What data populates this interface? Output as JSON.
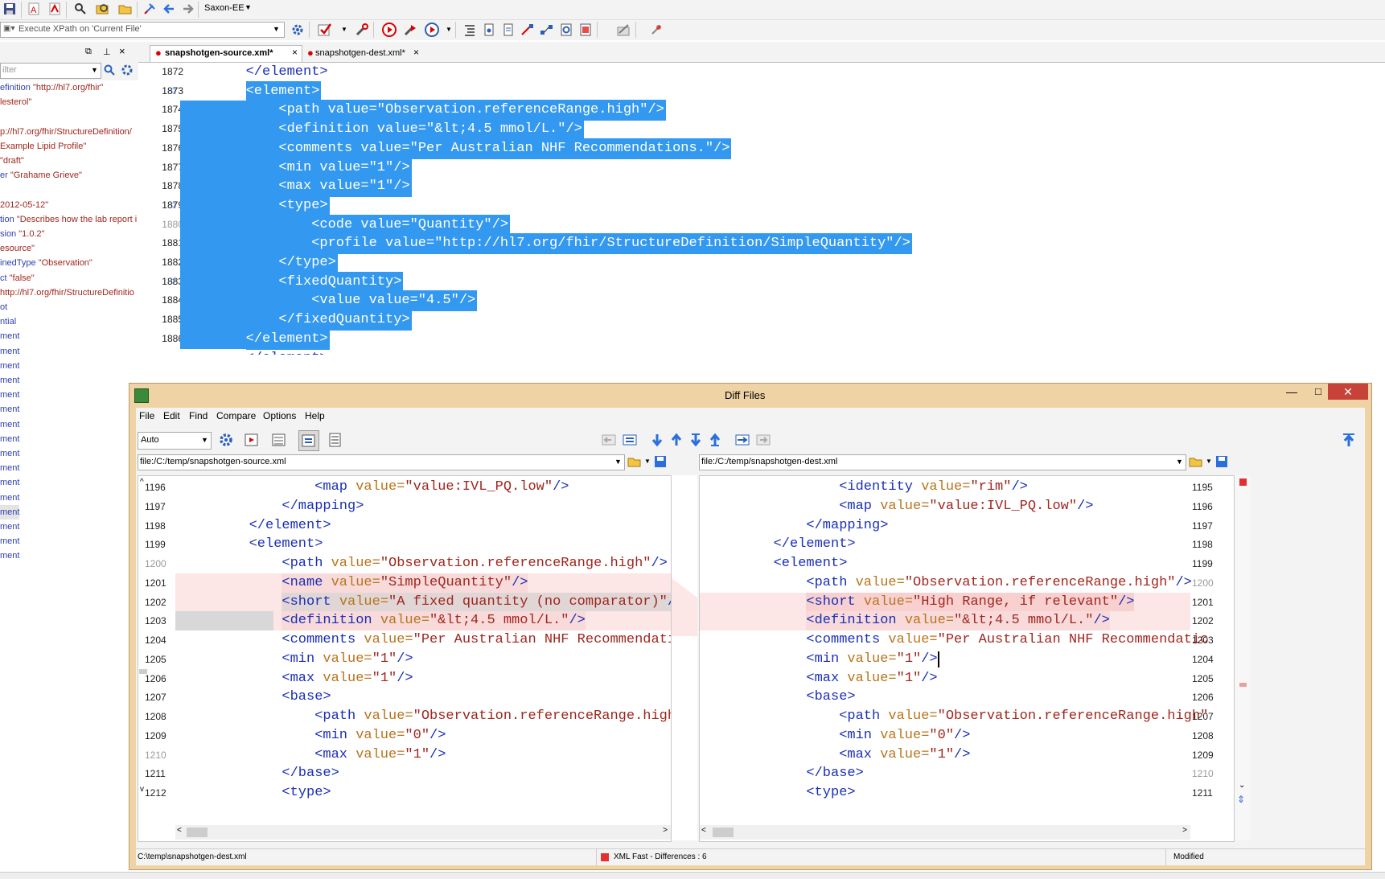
{
  "toolbar": {
    "transformer": "Saxon-EE",
    "xpath_label": "Execute XPath on 'Current File'"
  },
  "tabs": [
    {
      "label": "snapshotgen-source.xml*"
    },
    {
      "label": "snapshotgen-dest.xml*"
    }
  ],
  "outline": {
    "filter_placeholder": "ilter",
    "items": [
      {
        "name": "efinition",
        "value": "\"http://hl7.org/fhir\""
      },
      {
        "name": "",
        "value": "lesterol\""
      },
      {
        "name": "",
        "value": ""
      },
      {
        "name": "",
        "value": "p://hl7.org/fhir/StructureDefinition/"
      },
      {
        "name": "",
        "value": "Example Lipid Profile\""
      },
      {
        "name": "",
        "value": "\"draft\""
      },
      {
        "name": "er",
        "value": "\"Grahame Grieve\""
      },
      {
        "name": "",
        "value": ""
      },
      {
        "name": "",
        "value": "2012-05-12\""
      },
      {
        "name": "tion",
        "value": "\"Describes how the lab report i"
      },
      {
        "name": "sion",
        "value": "\"1.0.2\""
      },
      {
        "name": "",
        "value": "esource\""
      },
      {
        "name": "inedType",
        "value": "\"Observation\""
      },
      {
        "name": "ct",
        "value": "\"false\""
      },
      {
        "name": "",
        "value": "http://hl7.org/fhir/StructureDefinitio"
      },
      {
        "name": "ot",
        "value": ""
      },
      {
        "name": "ntial",
        "value": ""
      },
      {
        "name": "ment",
        "value": ""
      },
      {
        "name": "ment",
        "value": ""
      },
      {
        "name": "ment",
        "value": ""
      },
      {
        "name": "ment",
        "value": ""
      },
      {
        "name": "ment",
        "value": ""
      },
      {
        "name": "ment",
        "value": ""
      },
      {
        "name": "ment",
        "value": ""
      },
      {
        "name": "ment",
        "value": ""
      },
      {
        "name": "ment",
        "value": ""
      },
      {
        "name": "ment",
        "value": ""
      },
      {
        "name": "ment",
        "value": ""
      },
      {
        "name": "ment",
        "value": ""
      },
      {
        "name": "ment",
        "value": ""
      },
      {
        "name": "ment",
        "value": ""
      },
      {
        "name": "ment",
        "value": ""
      },
      {
        "name": "ment",
        "value": ""
      }
    ]
  },
  "editor": {
    "lines": [
      {
        "n": "1872",
        "indent": 8,
        "parts": [
          [
            "tag",
            "</element>"
          ]
        ],
        "selected": false,
        "fold": false
      },
      {
        "n": "1873",
        "indent": 8,
        "parts": [
          [
            "tag",
            "<element>"
          ]
        ],
        "selected": true,
        "fold": true
      },
      {
        "n": "1874",
        "indent": 12,
        "parts": [
          [
            "tag",
            "<path value=\"Observation.referenceRange.high\"/>"
          ]
        ],
        "selected": true,
        "fold": false
      },
      {
        "n": "1875",
        "indent": 12,
        "parts": [
          [
            "tag",
            "<definition value=\"&lt;4.5 mmol/L.\"/>"
          ]
        ],
        "selected": true,
        "fold": false
      },
      {
        "n": "1876",
        "indent": 12,
        "parts": [
          [
            "tag",
            "<comments value=\"Per Australian NHF Recommendations.\"/>"
          ]
        ],
        "selected": true,
        "fold": false
      },
      {
        "n": "1877",
        "indent": 12,
        "parts": [
          [
            "tag",
            "<min value=\"1\"/>"
          ]
        ],
        "selected": true,
        "fold": false
      },
      {
        "n": "1878",
        "indent": 12,
        "parts": [
          [
            "tag",
            "<max value=\"1\"/>"
          ]
        ],
        "selected": true,
        "fold": false
      },
      {
        "n": "1879",
        "indent": 12,
        "parts": [
          [
            "tag",
            "<type>"
          ]
        ],
        "selected": true,
        "fold": true
      },
      {
        "n": "1880",
        "indent": 16,
        "parts": [
          [
            "tag",
            "<code value=\"Quantity\"/>"
          ]
        ],
        "selected": true,
        "fold": false
      },
      {
        "n": "1881",
        "indent": 16,
        "parts": [
          [
            "tag",
            "<profile value=\"http://hl7.org/fhir/StructureDefinition/SimpleQuantity\"/>"
          ]
        ],
        "selected": true,
        "fold": false
      },
      {
        "n": "1882",
        "indent": 12,
        "parts": [
          [
            "tag",
            "</type>"
          ]
        ],
        "selected": true,
        "fold": false
      },
      {
        "n": "1883",
        "indent": 12,
        "parts": [
          [
            "tag",
            "<fixedQuantity>"
          ]
        ],
        "selected": true,
        "fold": true
      },
      {
        "n": "1884",
        "indent": 16,
        "parts": [
          [
            "tag",
            "<value value=\"4.5\"/>"
          ]
        ],
        "selected": true,
        "fold": false
      },
      {
        "n": "1885",
        "indent": 12,
        "parts": [
          [
            "tag",
            "</fixedQuantity>"
          ]
        ],
        "selected": true,
        "fold": false
      },
      {
        "n": "1886",
        "indent": 8,
        "parts": [
          [
            "tag",
            "</element>"
          ]
        ],
        "selected": true,
        "fold": false
      }
    ]
  },
  "diff": {
    "title": "Diff Files",
    "menu": [
      "File",
      "Edit",
      "Find",
      "Compare",
      "Options",
      "Help"
    ],
    "mode": "Auto",
    "left_path": "file:/C:/temp/snapshotgen-source.xml",
    "right_path": "file:/C:/temp/snapshotgen-dest.xml",
    "status_path": "C:\\temp\\snapshotgen-dest.xml",
    "status_diff": "XML Fast - Differences : 6",
    "status_modified": "Modified",
    "left_lines": [
      {
        "n": "1196",
        "indent": 16,
        "parts": [
          [
            "tag",
            "<map "
          ],
          [
            "attr",
            "value="
          ],
          [
            "val",
            "\"value:IVL_PQ.low\""
          ],
          [
            "tag",
            "/>"
          ]
        ],
        "hl": ""
      },
      {
        "n": "1197",
        "indent": 12,
        "parts": [
          [
            "tag",
            "</mapping>"
          ]
        ],
        "hl": ""
      },
      {
        "n": "1198",
        "indent": 8,
        "parts": [
          [
            "tag",
            "</element>"
          ]
        ],
        "hl": ""
      },
      {
        "n": "1199",
        "indent": 8,
        "parts": [
          [
            "tag",
            "<element>"
          ]
        ],
        "hl": ""
      },
      {
        "n": "1200",
        "indent": 12,
        "parts": [
          [
            "tag",
            "<path "
          ],
          [
            "attr",
            "value="
          ],
          [
            "val",
            "\"Observation.referenceRange.high\""
          ],
          [
            "tag",
            "/>"
          ]
        ],
        "hl": ""
      },
      {
        "n": "1201",
        "indent": 12,
        "parts": [
          [
            "tag",
            "<name "
          ],
          [
            "attr",
            "value="
          ],
          [
            "val",
            "\"SimpleQuantity\""
          ],
          [
            "tag",
            "/>"
          ]
        ],
        "hl": "pink"
      },
      {
        "n": "1202",
        "indent": 12,
        "parts": [
          [
            "tag",
            "<short "
          ],
          [
            "attr",
            "value="
          ],
          [
            "val",
            "\"A fixed quantity (no comparator)\""
          ],
          [
            "tag",
            "/>"
          ]
        ],
        "hl": "pinkstrong"
      },
      {
        "n": "1203",
        "indent": 12,
        "parts": [
          [
            "tag",
            "<definition "
          ],
          [
            "attr",
            "value="
          ],
          [
            "val",
            "\"&lt;4.5 mmol/L.\""
          ],
          [
            "tag",
            "/>"
          ]
        ],
        "hl": "pinkgray"
      },
      {
        "n": "1204",
        "indent": 12,
        "parts": [
          [
            "tag",
            "<comments "
          ],
          [
            "attr",
            "value="
          ],
          [
            "val",
            "\"Per Australian NHF Recommendatio"
          ]
        ],
        "hl": ""
      },
      {
        "n": "1205",
        "indent": 12,
        "parts": [
          [
            "tag",
            "<min "
          ],
          [
            "attr",
            "value="
          ],
          [
            "val",
            "\"1\""
          ],
          [
            "tag",
            "/>"
          ]
        ],
        "hl": ""
      },
      {
        "n": "1206",
        "indent": 12,
        "parts": [
          [
            "tag",
            "<max "
          ],
          [
            "attr",
            "value="
          ],
          [
            "val",
            "\"1\""
          ],
          [
            "tag",
            "/>"
          ]
        ],
        "hl": ""
      },
      {
        "n": "1207",
        "indent": 12,
        "parts": [
          [
            "tag",
            "<base>"
          ]
        ],
        "hl": ""
      },
      {
        "n": "1208",
        "indent": 16,
        "parts": [
          [
            "tag",
            "<path "
          ],
          [
            "attr",
            "value="
          ],
          [
            "val",
            "\"Observation.referenceRange.high\""
          ]
        ],
        "hl": ""
      },
      {
        "n": "1209",
        "indent": 16,
        "parts": [
          [
            "tag",
            "<min "
          ],
          [
            "attr",
            "value="
          ],
          [
            "val",
            "\"0\""
          ],
          [
            "tag",
            "/>"
          ]
        ],
        "hl": ""
      },
      {
        "n": "1210",
        "indent": 16,
        "parts": [
          [
            "tag",
            "<max "
          ],
          [
            "attr",
            "value="
          ],
          [
            "val",
            "\"1\""
          ],
          [
            "tag",
            "/>"
          ]
        ],
        "hl": ""
      },
      {
        "n": "1211",
        "indent": 12,
        "parts": [
          [
            "tag",
            "</base>"
          ]
        ],
        "hl": ""
      },
      {
        "n": "1212",
        "indent": 12,
        "parts": [
          [
            "tag",
            "<type>"
          ]
        ],
        "hl": ""
      }
    ],
    "right_lines": [
      {
        "n": "1195",
        "indent": 16,
        "parts": [
          [
            "tag",
            "<identity "
          ],
          [
            "attr",
            "value="
          ],
          [
            "val",
            "\"rim\""
          ],
          [
            "tag",
            "/>"
          ]
        ],
        "hl": ""
      },
      {
        "n": "1196",
        "indent": 16,
        "parts": [
          [
            "tag",
            "<map "
          ],
          [
            "attr",
            "value="
          ],
          [
            "val",
            "\"value:IVL_PQ.low\""
          ],
          [
            "tag",
            "/>"
          ]
        ],
        "hl": ""
      },
      {
        "n": "1197",
        "indent": 12,
        "parts": [
          [
            "tag",
            "</mapping>"
          ]
        ],
        "hl": ""
      },
      {
        "n": "1198",
        "indent": 8,
        "parts": [
          [
            "tag",
            "</element>"
          ]
        ],
        "hl": ""
      },
      {
        "n": "1199",
        "indent": 8,
        "parts": [
          [
            "tag",
            "<element>"
          ]
        ],
        "hl": ""
      },
      {
        "n": "1200",
        "indent": 12,
        "parts": [
          [
            "tag",
            "<path "
          ],
          [
            "attr",
            "value="
          ],
          [
            "val",
            "\"Observation.referenceRange.high\""
          ],
          [
            "tag",
            "/>"
          ]
        ],
        "hl": ""
      },
      {
        "n": "1201",
        "indent": 12,
        "parts": [
          [
            "tag",
            "<short "
          ],
          [
            "attr",
            "value="
          ],
          [
            "val",
            "\"High Range, if relevant\""
          ],
          [
            "tag",
            "/>"
          ]
        ],
        "hl": "pinkstrong"
      },
      {
        "n": "1202",
        "indent": 12,
        "parts": [
          [
            "tag",
            "<definition "
          ],
          [
            "attr",
            "value="
          ],
          [
            "val",
            "\"&lt;4.5 mmol/L.\""
          ],
          [
            "tag",
            "/>"
          ]
        ],
        "hl": "pink"
      },
      {
        "n": "1203",
        "indent": 12,
        "parts": [
          [
            "tag",
            "<comments "
          ],
          [
            "attr",
            "value="
          ],
          [
            "val",
            "\"Per Australian NHF Recommendatic"
          ]
        ],
        "hl": ""
      },
      {
        "n": "1204",
        "indent": 12,
        "parts": [
          [
            "tag",
            "<min "
          ],
          [
            "attr",
            "value="
          ],
          [
            "val",
            "\"1\""
          ],
          [
            "tag",
            "/>"
          ]
        ],
        "hl": ""
      },
      {
        "n": "1205",
        "indent": 12,
        "parts": [
          [
            "tag",
            "<max "
          ],
          [
            "attr",
            "value="
          ],
          [
            "val",
            "\"1\""
          ],
          [
            "tag",
            "/>"
          ]
        ],
        "hl": ""
      },
      {
        "n": "1206",
        "indent": 12,
        "parts": [
          [
            "tag",
            "<base>"
          ]
        ],
        "hl": ""
      },
      {
        "n": "1207",
        "indent": 16,
        "parts": [
          [
            "tag",
            "<path "
          ],
          [
            "attr",
            "value="
          ],
          [
            "val",
            "\"Observation.referenceRange.high\""
          ]
        ],
        "hl": ""
      },
      {
        "n": "1208",
        "indent": 16,
        "parts": [
          [
            "tag",
            "<min "
          ],
          [
            "attr",
            "value="
          ],
          [
            "val",
            "\"0\""
          ],
          [
            "tag",
            "/>"
          ]
        ],
        "hl": ""
      },
      {
        "n": "1209",
        "indent": 16,
        "parts": [
          [
            "tag",
            "<max "
          ],
          [
            "attr",
            "value="
          ],
          [
            "val",
            "\"1\""
          ],
          [
            "tag",
            "/>"
          ]
        ],
        "hl": ""
      },
      {
        "n": "1210",
        "indent": 12,
        "parts": [
          [
            "tag",
            "</base>"
          ]
        ],
        "hl": ""
      },
      {
        "n": "1211",
        "indent": 12,
        "parts": [
          [
            "tag",
            "<type>"
          ]
        ],
        "hl": ""
      }
    ]
  },
  "colors": {
    "selection": "#3398ef",
    "tag": "#1a2fb8",
    "attr": "#b8741c",
    "value": "#a0261e",
    "diff_pink": "#fde6e6",
    "diff_pink_strong": "#f9d3d3",
    "diff_window_frame": "#f0d3a4"
  }
}
